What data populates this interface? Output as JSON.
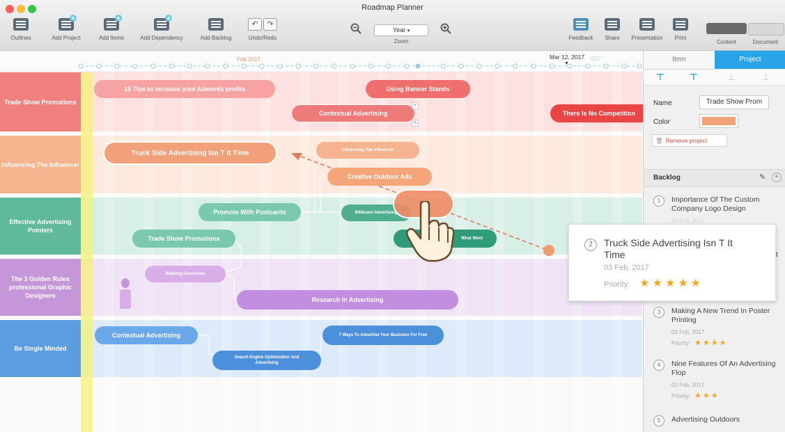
{
  "window": {
    "title": "Roadmap Planner"
  },
  "toolbar": {
    "outlines": "Outlines",
    "add_project": "Add Project",
    "add_items": "Add Items",
    "add_dependency": "Add Dependency",
    "add_backlog": "Add Backlog",
    "undo_redo": "Undo/Redo",
    "zoom_value": "Year",
    "zoom_label": "Zoom",
    "feedback": "Feedback",
    "share": "Share",
    "presentation": "Presentation",
    "print": "Print",
    "content": "Content",
    "document": "Document"
  },
  "timeline": {
    "month_label": "Feb 2017",
    "current_date": "Mar 12, 2017",
    "ghost_label": "017"
  },
  "lanes": [
    {
      "name": "Trade Show Promotions",
      "color": "#f08080"
    },
    {
      "name": "Influencing The Influencer",
      "color": "#f5b48e"
    },
    {
      "name": "Effective Advertising Pointers",
      "color": "#5fb99a"
    },
    {
      "name": "The 3 Golden Rules professional Graphic Designers",
      "color": "#c597d8"
    },
    {
      "name": "Be Single Minded",
      "color": "#5b9de0"
    }
  ],
  "tasks": {
    "t1": "15 Tips to increase your Adwords profits",
    "t2": "Using Banner Stands",
    "t3": "Contextual Advertising",
    "t4": "There Is No Competition",
    "t5": "Truck Side Advertising Isn T It Time",
    "t6": "Influencing The Influencer",
    "t7": "Creative Outdoor Ads",
    "t8": "Promote With Postcards",
    "t9": "Billboard Advertising",
    "t10": "Trade Show Promotions",
    "t11": "What Went",
    "t12": "Building Directories",
    "t13": "Research In Advertising",
    "t14": "Contextual Advertising",
    "t15": "Search Engine Optimization And Advertising",
    "t16": "7 Ways To Advertise Your Business For Free"
  },
  "panel": {
    "tab_item": "Item",
    "tab_project": "Project",
    "name_label": "Name",
    "name_value": "Trade Show Prom",
    "color_label": "Color",
    "color_value": "#f0a178",
    "remove": "Remove project",
    "backlog_title": "Backlog",
    "backlog": [
      {
        "num": "1",
        "title": "Importance Of The Custom Company Logo Design",
        "date": "03 Feb, 2017"
      },
      {
        "num": "3",
        "title": "Making A New Trend In Poster Printing",
        "date": "03 Feb, 2017",
        "priority_label": "Priority:",
        "stars": "★★★★"
      },
      {
        "num": "4",
        "title": "Nine Features Of An Advertising Flop",
        "date": "03 Feb, 2017",
        "priority_label": "Priority:",
        "stars": "★★★"
      },
      {
        "num": "5",
        "title": "Advertising Outdoors"
      }
    ],
    "partial_letter": "t"
  },
  "drag_card": {
    "num": "2",
    "title": "Truck Side Advertising Isn T It Time",
    "date": "03 Feb, 2017",
    "priority_label": "Priority:",
    "stars": "★★★★★"
  }
}
